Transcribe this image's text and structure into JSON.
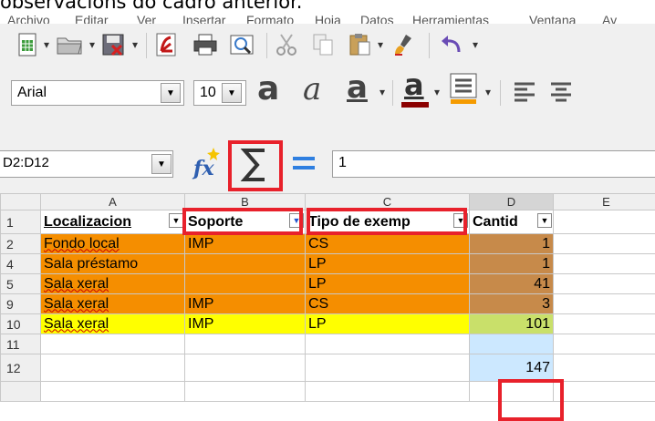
{
  "caption": "observacións do cadro anterior.",
  "menu": [
    "Archivo",
    "Editar",
    "Ver",
    "Insertar",
    "Formato",
    "Hoja",
    "Datos",
    "Herramientas",
    "Ventana",
    "Ay"
  ],
  "font_name": "Arial",
  "font_size": "10",
  "format_letters": {
    "bold": "a",
    "italic": "a",
    "underline": "a",
    "font_color": "a"
  },
  "name_box": "D2:D12",
  "formula_input": "1",
  "icons": {
    "new": "new-spreadsheet-icon",
    "open": "open-folder-icon",
    "save": "save-icon",
    "pdf": "export-pdf-icon",
    "print": "print-icon",
    "preview": "print-preview-icon",
    "cut": "cut-icon",
    "copy": "copy-icon",
    "paste": "paste-icon",
    "clone": "clone-formatting-icon",
    "undo": "undo-icon",
    "function_wizard": "function-wizard-icon",
    "sum": "sum-icon",
    "equals": "formula-equals-icon"
  },
  "colors": {
    "highlight_red": "#e8212b",
    "orange": "#f58e00",
    "yellow": "#ffff00",
    "selection": "#cce8ff"
  },
  "grid": {
    "columns": [
      "A",
      "B",
      "C",
      "D",
      "E"
    ],
    "header_row": {
      "row": "1",
      "cells": [
        "Localizacion",
        "Soporte",
        "Tipo de exemp",
        "Cantid"
      ]
    },
    "rows": [
      {
        "row": "2",
        "a": "Fondo local",
        "b": "IMP",
        "c": "CS",
        "d": "1"
      },
      {
        "row": "4",
        "a": "Sala préstamo",
        "b": "",
        "c": "LP",
        "d": "1"
      },
      {
        "row": "5",
        "a": "Sala xeral",
        "b": "",
        "c": "LP",
        "d": "41"
      },
      {
        "row": "9",
        "a": "Sala xeral",
        "b": "IMP",
        "c": "CS",
        "d": "3"
      },
      {
        "row": "10",
        "a": "Sala xeral",
        "b": "IMP",
        "c": "LP",
        "d": "101"
      },
      {
        "row": "11",
        "a": "",
        "b": "",
        "c": "",
        "d": ""
      },
      {
        "row": "12",
        "a": "",
        "b": "",
        "c": "",
        "d": "147"
      }
    ]
  }
}
